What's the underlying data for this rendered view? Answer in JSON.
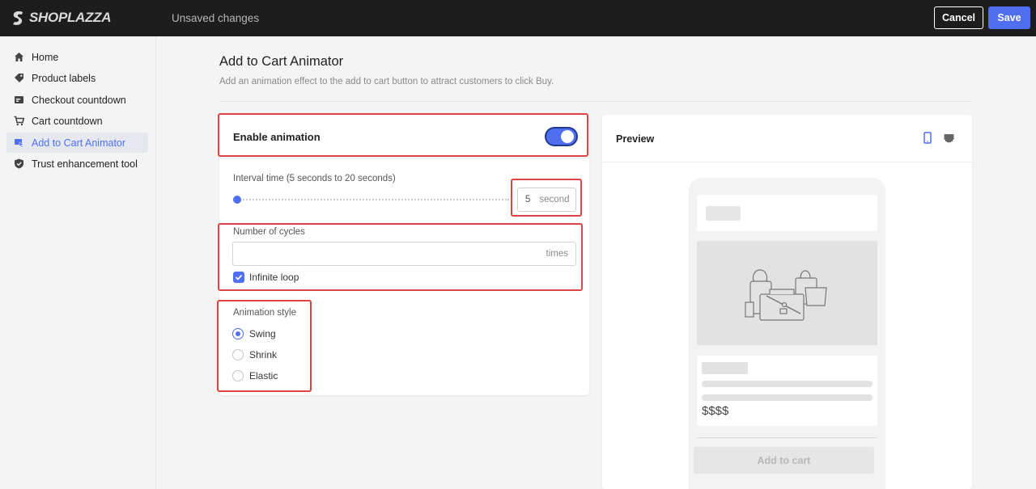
{
  "app": {
    "logo_text": "SHOPLAZZA",
    "status": "Unsaved changes",
    "cancel_label": "Cancel",
    "save_label": "Save",
    "accent_color": "#4f6ef0"
  },
  "sidebar": {
    "items": [
      {
        "label": "Home",
        "icon": "home-icon",
        "active": false
      },
      {
        "label": "Product labels",
        "icon": "tag-icon",
        "active": false
      },
      {
        "label": "Checkout countdown",
        "icon": "countdown-card-icon",
        "active": false
      },
      {
        "label": "Cart countdown",
        "icon": "cart-icon",
        "active": false
      },
      {
        "label": "Add to Cart Animator",
        "icon": "cart-animator-icon",
        "active": true
      },
      {
        "label": "Trust enhancement tool",
        "icon": "shield-check-icon",
        "active": false
      }
    ]
  },
  "page": {
    "title": "Add to Cart Animator",
    "description": "Add an animation effect to the add to cart button to attract customers to click Buy."
  },
  "settings": {
    "enable_label": "Enable animation",
    "enable_on": true,
    "interval_label": "Interval time (5 seconds to 20 seconds)",
    "interval_value": "5",
    "interval_unit": "second",
    "interval_min": 5,
    "interval_max": 20,
    "cycles_label": "Number of cycles",
    "cycles_value": "",
    "cycles_unit": "times",
    "infinite_loop_label": "Infinite loop",
    "infinite_loop_checked": true,
    "style_label": "Animation style",
    "styles": [
      {
        "label": "Swing",
        "selected": true
      },
      {
        "label": "Shrink",
        "selected": false
      },
      {
        "label": "Elastic",
        "selected": false
      }
    ]
  },
  "preview": {
    "title": "Preview",
    "price": "$$$$",
    "add_to_cart_label": "Add to cart",
    "device_icons": [
      "mobile-icon",
      "desktop-icon"
    ]
  },
  "highlight_color": "#e04343"
}
